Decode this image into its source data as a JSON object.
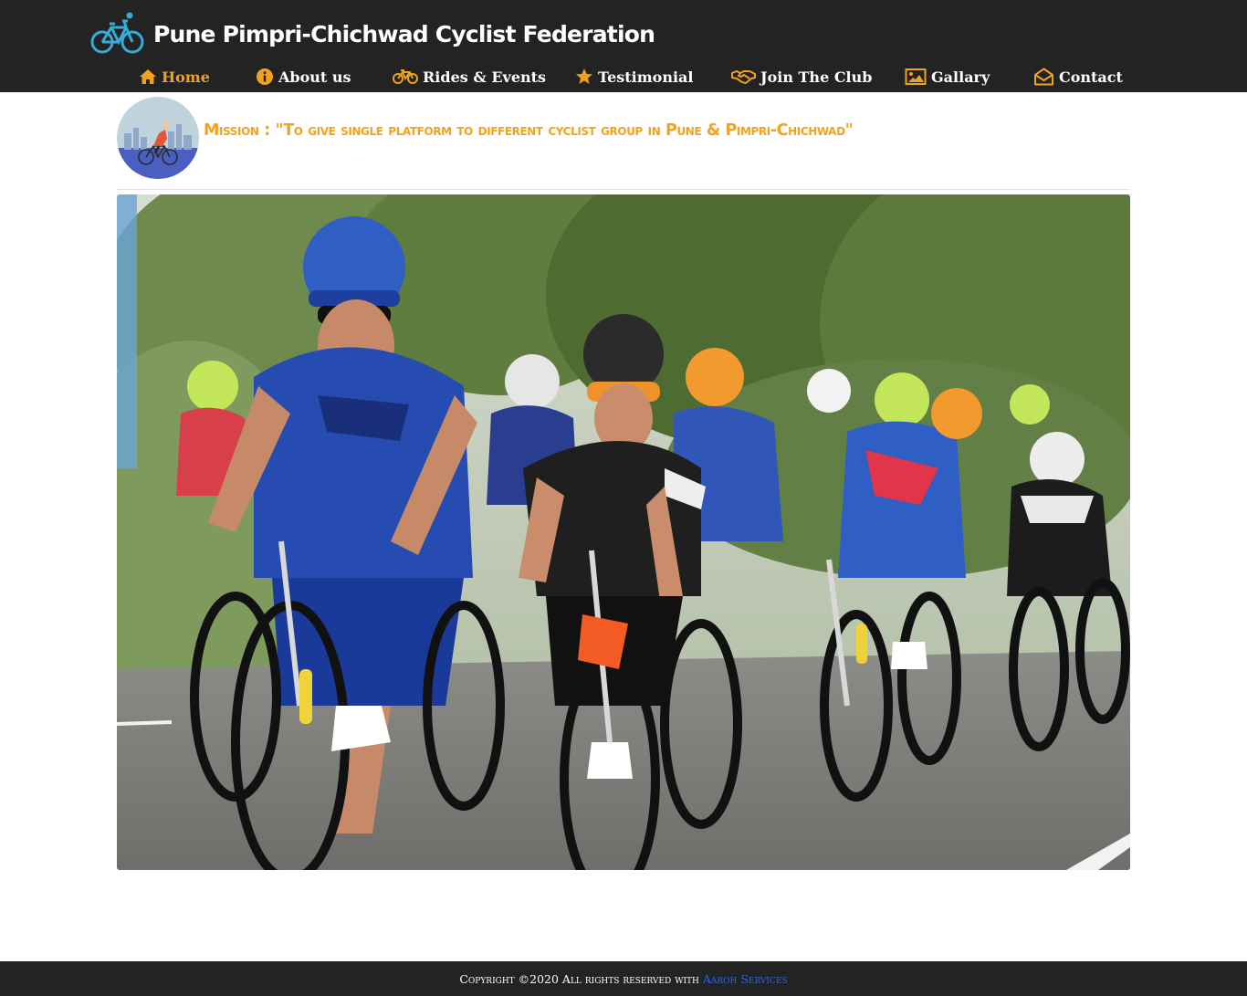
{
  "brand": {
    "title": "Pune Pimpri-Chichwad Cyclist Federation",
    "logo_icon": "bicycle-logo-icon"
  },
  "nav": {
    "items": [
      {
        "label": "Home",
        "icon": "home-icon",
        "active": true
      },
      {
        "label": "About us",
        "icon": "info-icon",
        "active": false
      },
      {
        "label": "Rides & Events",
        "icon": "bicycle-icon",
        "active": false
      },
      {
        "label": "Testimonial",
        "icon": "star-icon",
        "active": false
      },
      {
        "label": "Join The Club",
        "icon": "handshake-icon",
        "active": false
      },
      {
        "label": "Gallary",
        "icon": "image-icon",
        "active": false
      },
      {
        "label": "Contact",
        "icon": "envelope-open-icon",
        "active": false
      }
    ]
  },
  "mission": {
    "text": "Mission : \"To give single platform to different cyclist group in Pune & Pimpri-Chichwad\""
  },
  "footer": {
    "copyright": "Copyright ©2020 All rights reserved with",
    "link": "Aaroh Services"
  },
  "colors": {
    "header_bg": "#232323",
    "accent": "#f0a21c",
    "mission_text": "#f4a21b",
    "link": "#2d64e6"
  }
}
